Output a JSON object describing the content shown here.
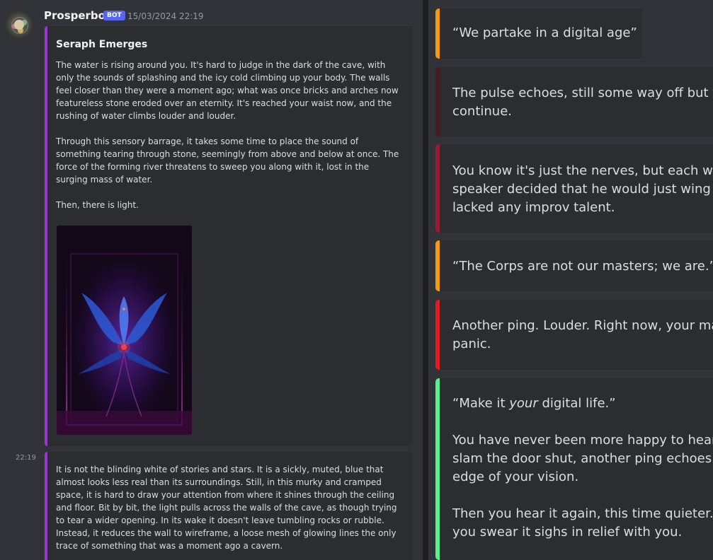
{
  "message": {
    "username": "Prosperbot",
    "bot_tag": "BOT",
    "timestamp": "15/03/2024 22:19",
    "side_time": "22:19"
  },
  "embed1": {
    "title": "Seraph Emerges",
    "paragraphs": [
      "The water is rising around you. It's hard to judge in the dark of the cave, with only the sounds of splashing and the icy cold climbing up your body. The walls feel closer than they were a moment ago; what was once bricks and arches now featureless stone eroded over an eternity. It's reached your waist now, and the rushing of water climbs louder and louder.",
      "Through this sensory barrage, it takes some time to place the sound of something tearing through stone, seemingly from above and below at once. The force of the forming river threatens to sweep you along with it, lost in the surging mass of water.",
      "Then, there is light."
    ],
    "border_color": "#9b35d6"
  },
  "embed2": {
    "paragraph": "It is not the blinding white of stories and stars. It is a sickly, muted, blue that almost looks less real than its surroundings. Still, in this murky and cramped space, it is hard to draw your attention from where it shines through the ceiling and floor. Bit by bit, the light pulls across the walls of the cave, as though trying to tear a wider opening. In its wake it doesn't leave tumbling rocks or rubble. Instead, it reduces the wall to wireframe, a loose mesh of glowing lines the only trace of something that was a moment ago a cavern."
  },
  "right_cards": [
    {
      "color": "#f39c12",
      "lines": [
        "“We partake in a digital age”"
      ]
    },
    {
      "color": "#4a1a22",
      "lines": [
        "The pulse echoes, still some way off but too",
        "continue."
      ]
    },
    {
      "color": "#9b1b30",
      "lines": [
        "You know it's just the nerves, but each word",
        "speaker decided that he would just wing it a",
        "lacked any improv talent."
      ]
    },
    {
      "color": "#f39c12",
      "lines": [
        "“The Corps are not our masters; we are.”"
      ]
    },
    {
      "color": "#e31b23",
      "lines": [
        "Another ping. Louder. Right now, your mast",
        "panic."
      ]
    },
    {
      "color": "#57f287",
      "lines": [
        "“Make it ",
        "your",
        " digital life.”",
        "You have never been more happy to hear th",
        "slam the door shut, another ping echoes. Yo",
        "edge of your vision.",
        "Then you hear it again, this time quieter. Yo",
        "you swear it sighs in relief with you."
      ]
    }
  ]
}
